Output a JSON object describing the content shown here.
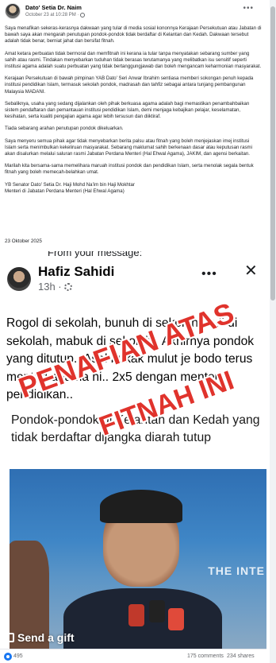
{
  "post": {
    "author": "Dato' Setia Dr. Naim",
    "meta": "October 23 at 10:28 PM ·",
    "paragraphs": [
      "Saya menafikan sekeras-kerasnya dakwaan yang tular di media sosial kononnya Kerajaan Persekutuan atau Jabatan di bawah saya akan mengarah penutupan pondok-pondok tidak berdaftar di Kelantan dan Kedah. Dakwaan tersebut adalah tidak benar, berniat jahat dan bersifat fitnah.",
      "Amat ketara perbuatan tidak bermoral dan memfitnah ini kerana ia tular tanpa menyatakan sebarang sumber yang sahih atau rasmi. Tindakan menyebarkan tuduhan tidak berasas terutamanya yang melibatkan isu sensitif seperti institusi agama adalah suatu perbuatan yang tidak bertanggungjawab dan boleh mengancam keharmonian masyarakat.",
      "Kerajaan Persekutuan di bawah pimpinan YAB Dato' Seri Anwar Ibrahim sentiasa memberi sokongan penuh kepada institusi pendidikan Islam, termasuk sekolah pondok, madrasah dan tahfiz sebagai antara tunjang pembangunan Malaysia MADANI.",
      "Sebaliknya, usaha yang sedang dijalankan oleh pihak berkuasa agama adalah bagi memastikan penambahbaikan sistem pendaftaran dan pemantauan institusi pendidikan Islam, demi menjaga kebajikan pelajar, keselamatan, kesihatan, serta kualiti pengajian agama agar lebih tersusun dan diiktiraf.",
      "Tiada sebarang arahan penutupan pondok dikeluarkan.",
      "Saya menyeru semua pihak agar tidak menyebarkan berita palsu atau fitnah yang boleh menjejaskan imej institusi Islam serta menimbulkan kekeliruan masyarakat. Sebarang maklumat sahih berkenaan dasar atau keputusan rasmi akan disalurkan melalui saluran rasmi Jabatan Perdana Menteri (Hal Ehwal Agama), JAKIM, dan agensi berkaitan.",
      "Marilah kita bersama-sama memelihara maruah institusi pondok dan pendidikan Islam, serta menolak segala bentuk fitnah yang boleh memecah-belahkan umat."
    ],
    "signature_line1": "YB Senator Dato' Setia Dr. Haji Mohd Na'im bin Haji Mokhtar",
    "signature_line2": "Menteri di Jabatan Perdana Menteri (Hal Ehwal Agama)",
    "date": "23 Oktober 2025"
  },
  "screenshot": {
    "cut_text": "From your message:",
    "name": "Hafiz Sahidi",
    "time": "13h ·",
    "text": "Rogol di sekolah, bunuh di sekolah, buli di sekolah, mabuk di sekolah.. Akhirnya pondok yang ditutup.. Asal bukak mulut je bodo terus menteri agama ni.. 2x5 dengan menteri pendidikan..",
    "image_caption": "Pondok-pondok di Kelantan dan Kedah yang tidak berdaftar dijangka diarah tutup",
    "photo_banner": "THE INTE",
    "overlay_line1": "PENAFIAN ATAS",
    "overlay_line2": "FITNAH INI",
    "gift_label": "Send a gift"
  },
  "footer": {
    "reactions": "495",
    "comments": "175 comments",
    "shares": "234 shares"
  },
  "colors": {
    "link_blue": "#1877f2",
    "overlay_red": "#e0332c",
    "muted_gray": "#65676b"
  },
  "icons": [
    "avatar",
    "globe-icon",
    "more-icon",
    "gear-icon",
    "close-icon",
    "gift-icon",
    "like-reaction-icon"
  ]
}
